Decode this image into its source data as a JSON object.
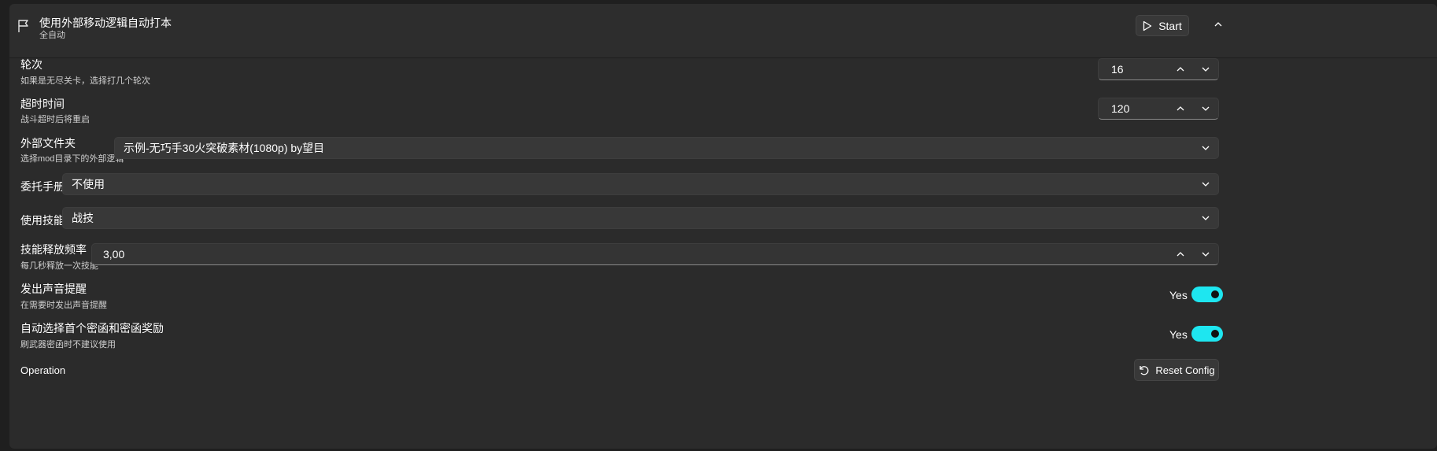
{
  "header": {
    "title": "使用外部移动逻辑自动打本",
    "subtitle": "全自动",
    "start_label": "Start",
    "icon": "flag-icon"
  },
  "settings": {
    "rounds": {
      "label": "轮次",
      "desc": "如果是无尽关卡，选择打几个轮次",
      "value": "16"
    },
    "timeout": {
      "label": "超时时间",
      "desc": "战斗超时后将重启",
      "value": "120"
    },
    "folder": {
      "label": "外部文件夹",
      "desc": "选择mod目录下的外部逻辑",
      "value": "示例-无巧手30火突破素材(1080p) by望目"
    },
    "manual": {
      "label": "委托手册",
      "value": "不使用"
    },
    "skill": {
      "label": "使用技能",
      "value": "战技"
    },
    "skill_freq": {
      "label": "技能释放频率",
      "desc": "每几秒释放一次技能",
      "value": "3,00"
    },
    "sound": {
      "label": "发出声音提醒",
      "desc": "在需要时发出声音提醒",
      "state": "Yes"
    },
    "auto_select": {
      "label": "自动选择首个密函和密函奖励",
      "desc": "刷武器密函时不建议使用",
      "state": "Yes"
    }
  },
  "footer": {
    "operation_label": "Operation",
    "reset_label": "Reset Config"
  },
  "colors": {
    "accent": "#1ee6f0",
    "panel": "#2b2b2b",
    "background": "#1f1f1f"
  }
}
